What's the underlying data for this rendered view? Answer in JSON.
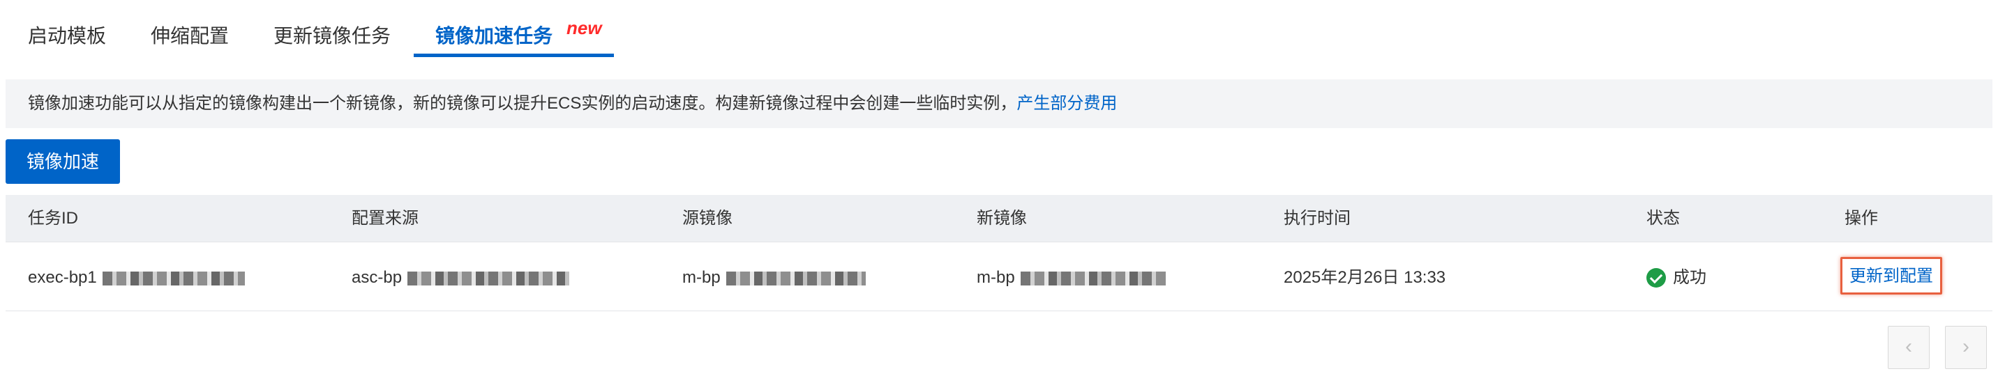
{
  "tabs": [
    {
      "label": "启动模板"
    },
    {
      "label": "伸缩配置"
    },
    {
      "label": "更新镜像任务"
    },
    {
      "label": "镜像加速任务",
      "badge": "new",
      "active": true
    }
  ],
  "notice": {
    "text": "镜像加速功能可以从指定的镜像构建出一个新镜像，新的镜像可以提升ECS实例的启动速度。构建新镜像过程中会创建一些临时实例，",
    "link": "产生部分费用"
  },
  "toolbar": {
    "primary_label": "镜像加速"
  },
  "table": {
    "headers": [
      "任务ID",
      "配置来源",
      "源镜像",
      "新镜像",
      "执行时间",
      "状态",
      "操作"
    ],
    "rows": [
      {
        "task_id": "exec-bp1",
        "config_source": "asc-bp",
        "source_image": "m-bp",
        "new_image": "m-bp",
        "exec_time": "2025年2月26日 13:33",
        "status": "成功",
        "action": "更新到配置"
      }
    ]
  },
  "pagination": {
    "prev": "‹",
    "next": "›"
  },
  "colors": {
    "accent": "#0064c8",
    "success": "#1e9c46",
    "badge": "#ff2b2b",
    "highlight": "#e8603f"
  }
}
